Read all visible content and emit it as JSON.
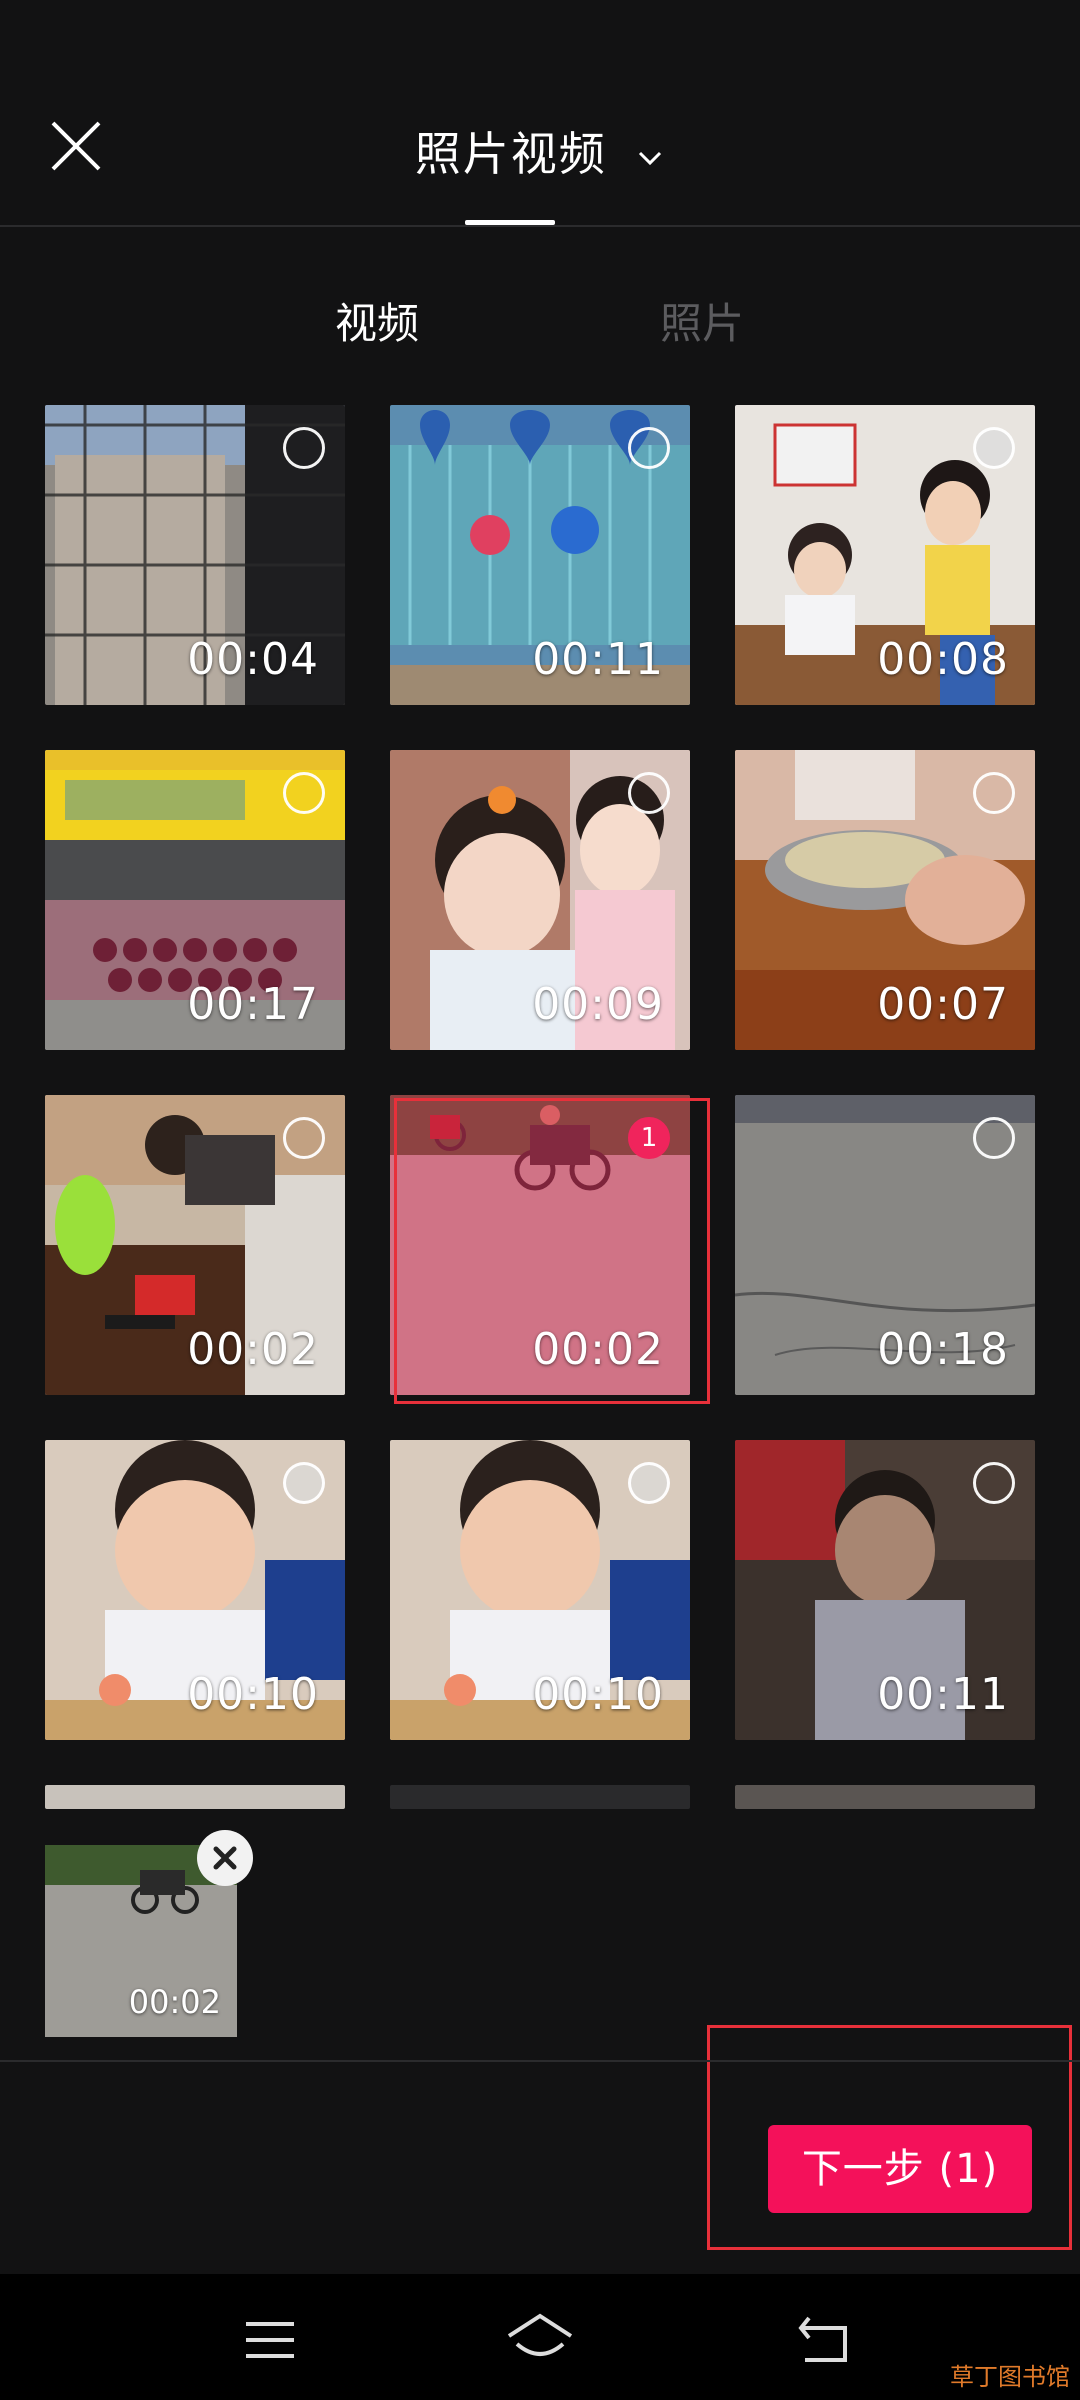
{
  "header": {
    "title": "照片视频",
    "close_icon": "close-icon",
    "dropdown_icon": "chevron-down-icon"
  },
  "subtabs": {
    "video": "视频",
    "photo": "照片"
  },
  "grid": {
    "items": [
      {
        "duration": "00:04"
      },
      {
        "duration": "00:11"
      },
      {
        "duration": "00:08"
      },
      {
        "duration": "00:17"
      },
      {
        "duration": "00:09"
      },
      {
        "duration": "00:07"
      },
      {
        "duration": "00:02"
      },
      {
        "duration": "00:02",
        "selected_index": "1"
      },
      {
        "duration": "00:18"
      },
      {
        "duration": "00:10"
      },
      {
        "duration": "00:10"
      },
      {
        "duration": "00:11"
      }
    ]
  },
  "tray": {
    "items": [
      {
        "duration": "00:02"
      }
    ]
  },
  "next_button": "下一步 (1)",
  "watermark": "草丁图书馆",
  "colors": {
    "accent": "#f4115a",
    "background": "#121213",
    "annotation": "#e8303a"
  }
}
